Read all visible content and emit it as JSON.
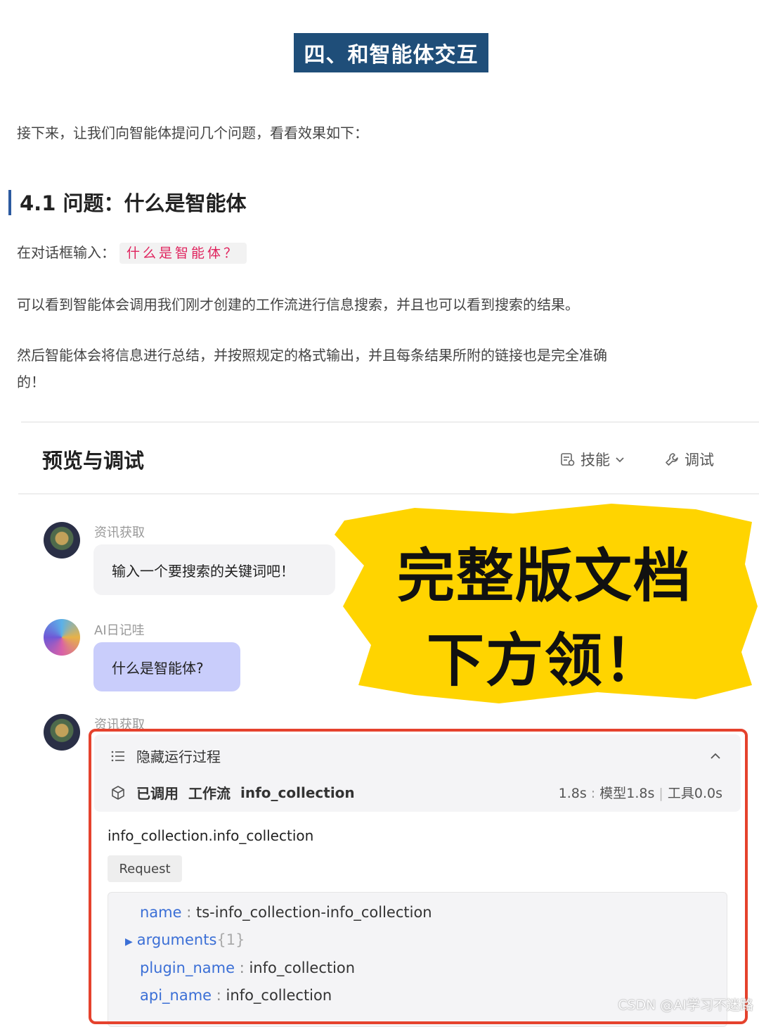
{
  "article": {
    "section_heading": "四、和智能体交互",
    "intro": "接下来，让我们向智能体提问几个问题，看看效果如下：",
    "subheading": "4.1 问题：什么是智能体",
    "input_prompt_label": "在对话框输入：",
    "input_prompt_code": "什么是智能体？",
    "para_search": "可以看到智能体会调用我们刚才创建的工作流进行信息搜索，并且也可以看到搜索的结果。",
    "para_summary_line1": "然后智能体会将信息进行总结，并按照规定的格式输出，并且每条结果所附的链接也是完全准确",
    "para_summary_line2": "的！"
  },
  "preview": {
    "title": "预览与调试",
    "skills_label": "技能",
    "debug_label": "调试",
    "messages": [
      {
        "sender": "资讯获取",
        "text": "输入一个要搜索的关键词吧！"
      },
      {
        "sender": "AI日记哇",
        "text": "什么是智能体?"
      },
      {
        "sender": "资讯获取"
      }
    ],
    "process": {
      "toggle_label": "隐藏运行过程",
      "call_prefix": "已调用",
      "call_type": "工作流",
      "call_name": "info_collection",
      "timing_total": "1.8s",
      "timing_model": "模型1.8s",
      "timing_tool": "工具0.0s",
      "function_name": "info_collection.info_collection",
      "request_label": "Request",
      "fields": {
        "name_key": "name",
        "name_value": "ts-info_collection-info_collection",
        "arguments_key": "arguments",
        "arguments_count": "{1}",
        "plugin_name_key": "plugin_name",
        "plugin_name_value": "info_collection",
        "api_name_key": "api_name",
        "api_name_value": "info_collection"
      }
    }
  },
  "promo": {
    "line1": "完整版文档",
    "line2": "下方领！",
    "color": "#ffd400"
  },
  "watermark": "CSDN @AI学习不迷路"
}
